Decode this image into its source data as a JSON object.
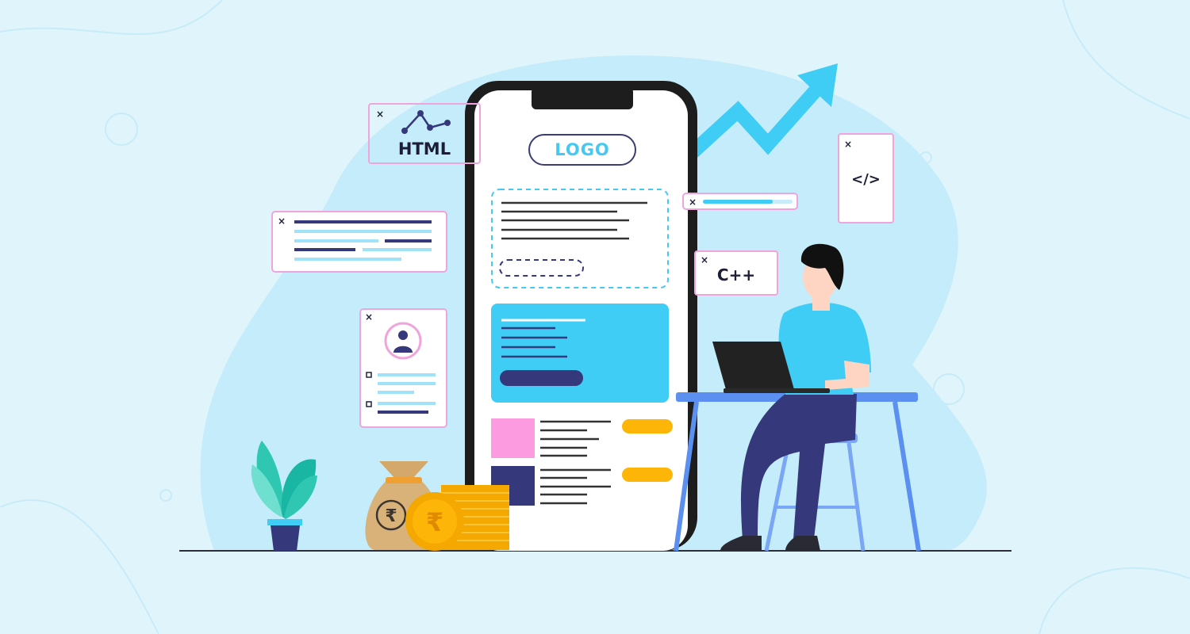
{
  "phone": {
    "logo_label": "LOGO"
  },
  "cards": {
    "html_label": "HTML",
    "code_label": "</>",
    "cpp_label": "C++",
    "close_glyph": "×"
  },
  "icons": {
    "currency": "rupee-icon",
    "chart": "line-chart-icon",
    "profile": "user-avatar-icon",
    "growth": "trend-up-arrow-icon"
  },
  "colors": {
    "background": "#e0f4fc",
    "blob": "#c4ecfa",
    "accent_blue": "#3fcdf5",
    "navy": "#35387a",
    "pink_border": "#f0a4dc",
    "pink_block": "#fd9be0",
    "gold": "#fdb507",
    "phone_frame": "#1d1d1d",
    "desk": "#5b8ff0"
  },
  "widgets": {
    "progress_fraction": 0.78
  }
}
